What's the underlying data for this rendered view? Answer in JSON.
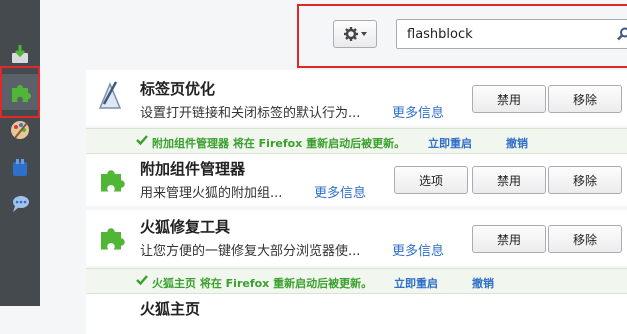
{
  "sidebar": {
    "items": [
      {
        "icon": "get-addons-icon"
      },
      {
        "icon": "extensions-icon",
        "selected": true
      },
      {
        "icon": "appearance-icon"
      },
      {
        "icon": "plugins-icon"
      },
      {
        "icon": "services-icon"
      }
    ]
  },
  "toolbar": {
    "gear_icon": "gear-icon",
    "search_value": "flashblock"
  },
  "addons": [
    {
      "title": "标签页优化",
      "description": "设置打开链接和关闭标签的默认行为...",
      "more_info": "更多信息",
      "buttons": {
        "disable": "禁用",
        "remove": "移除"
      }
    },
    {
      "notice": {
        "message": "附加组件管理器 将在 Firefox 重新启动后被更新。",
        "restart": "立即重启",
        "undo": "撤销"
      },
      "title": "附加组件管理器",
      "description": "用来管理火狐的附加组...",
      "more_info": "更多信息",
      "buttons": {
        "options": "选项",
        "disable": "禁用",
        "remove": "移除"
      }
    },
    {
      "title": "火狐修复工具",
      "description": "让您方便的一键修复大部分浏览器使...",
      "more_info": "更多信息",
      "buttons": {
        "disable": "禁用",
        "remove": "移除"
      }
    },
    {
      "notice": {
        "message": "火狐主页 将在 Firefox 重新启动后被更新。",
        "restart": "立即重启",
        "undo": "撤销"
      },
      "title": "火狐主页"
    }
  ],
  "colors": {
    "highlight": "#e02828",
    "link": "#2f6fc9",
    "notice_text": "#3aa02d",
    "puzzle_green": "#4fb636",
    "sidebar_bg": "#454a4f"
  }
}
